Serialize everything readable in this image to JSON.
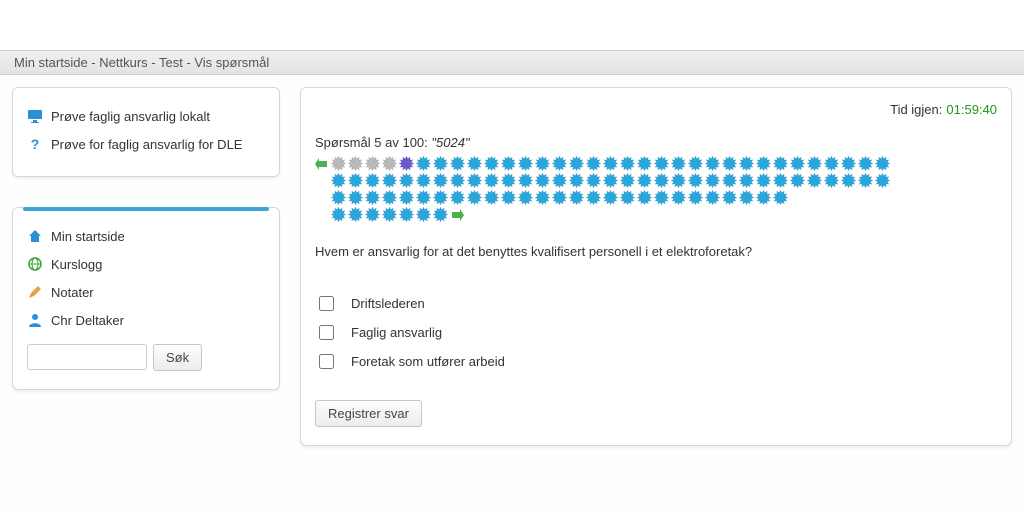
{
  "breadcrumb": "Min startside - Nettkurs - Test - Vis spørsmål",
  "sidebar_top": {
    "items": [
      {
        "label": "Prøve faglig ansvarlig lokalt",
        "icon": "monitor",
        "underlined": false
      },
      {
        "label": "Prøve for faglig ansvarlig for DLE",
        "icon": "question",
        "underlined": true
      }
    ]
  },
  "sidebar_bottom": {
    "items": [
      {
        "label": "Min startside",
        "icon": "home"
      },
      {
        "label": "Kurslogg",
        "icon": "globe"
      },
      {
        "label": "Notater",
        "icon": "pencil"
      },
      {
        "label": "Chr Deltaker",
        "icon": "user"
      }
    ],
    "search_button": "Søk",
    "search_placeholder": ""
  },
  "quiz": {
    "timer_label": "Tid igjen:",
    "timer_value": "01:59:40",
    "question_label_prefix": "Spørsmål",
    "question_number": 5,
    "question_of_word": "av",
    "question_total": 100,
    "question_id": "5024",
    "question_text": "Hvem er ansvarlig for at det benyttes kvalifisert personell i et elektroforetak?",
    "answers": [
      {
        "label": "Driftslederen"
      },
      {
        "label": "Faglig ansvarlig"
      },
      {
        "label": "Foretak som utfører arbeid"
      }
    ],
    "submit_label": "Registrer svar",
    "nav": {
      "total": 100,
      "answered_grey": 4,
      "current_index": 5,
      "rows": [
        33,
        33,
        27,
        7
      ]
    }
  },
  "colors": {
    "dot_unanswered": "#2aa6dd",
    "dot_grey": "#b8b8b8",
    "dot_current": "#6a5acd",
    "arrow": "#4caf50"
  }
}
